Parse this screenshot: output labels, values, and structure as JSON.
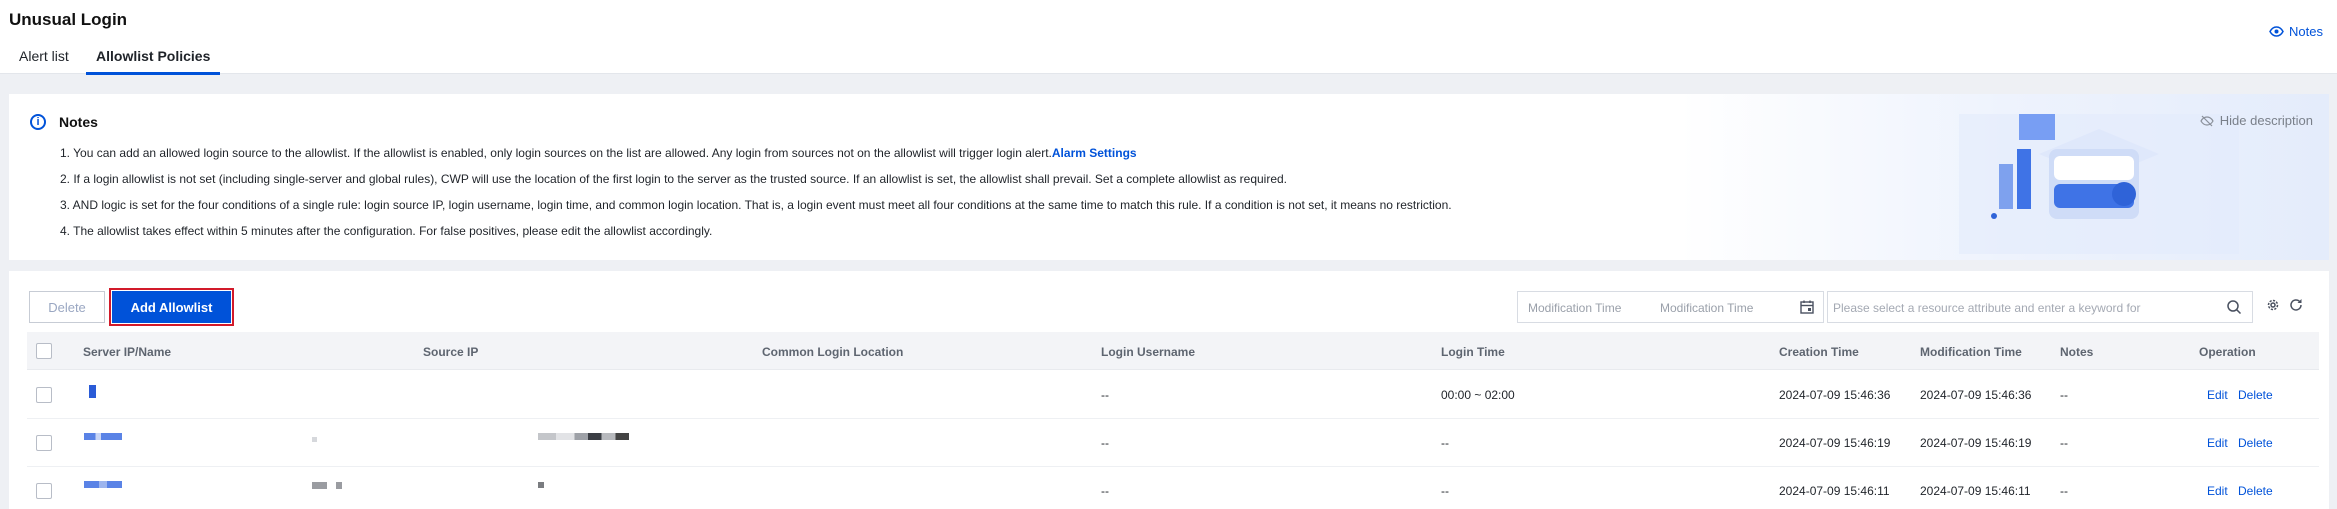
{
  "header": {
    "title": "Unusual Login",
    "notes_link": "Notes",
    "tabs": [
      {
        "label": "Alert list",
        "active": false
      },
      {
        "label": "Allowlist Policies",
        "active": true
      }
    ]
  },
  "notes": {
    "heading": "Notes",
    "hide_label": "Hide description",
    "lines": [
      "1. You can add an allowed login source to the allowlist. If the allowlist is enabled, only login sources on the list are allowed. Any login from sources not on the allowlist will trigger login alert.",
      "2. If a login allowlist is not set (including single-server and global rules), CWP will use the location of the first login to the server as the trusted source. If an allowlist is set, the allowlist shall prevail. Set a complete allowlist as required.",
      "3. AND logic is set for the four conditions of a single rule: login source IP, login username, login time, and common login location. That is, a login event must meet all four conditions at the same time to match this rule. If a condition is not set, it means no restriction.",
      "4. The allowlist takes effect within 5 minutes after the configuration. For false positives, please edit the allowlist accordingly."
    ],
    "alarm_settings_link": "Alarm Settings"
  },
  "toolbar": {
    "delete_label": "Delete",
    "add_label": "Add Allowlist",
    "date_start_placeholder": "Modification Time",
    "date_end_placeholder": "Modification Time",
    "search_placeholder": "Please select a resource attribute and enter a keyword for"
  },
  "table": {
    "columns": [
      "Server IP/Name",
      "Source IP",
      "Common Login Location",
      "Login Username",
      "Login Time",
      "Creation Time",
      "Modification Time",
      "Notes",
      "Operation"
    ],
    "rows": [
      {
        "login_username": "--",
        "login_time": "00:00 ~ 02:00",
        "creation_time": "2024-07-09 15:46:36",
        "modification_time": "2024-07-09 15:46:36",
        "notes": "--",
        "edit": "Edit",
        "delete": "Delete"
      },
      {
        "login_username": "--",
        "login_time": "--",
        "creation_time": "2024-07-09 15:46:19",
        "modification_time": "2024-07-09 15:46:19",
        "notes": "--",
        "edit": "Edit",
        "delete": "Delete"
      },
      {
        "login_username": "--",
        "login_time": "--",
        "creation_time": "2024-07-09 15:46:11",
        "modification_time": "2024-07-09 15:46:11",
        "notes": "--",
        "edit": "Edit",
        "delete": "Delete"
      }
    ]
  },
  "colors": {
    "accent": "#0052d9",
    "highlight_border": "#d21a2a"
  },
  "icons": [
    "eye-icon",
    "info-icon",
    "eye-off-icon",
    "calendar-icon",
    "search-icon",
    "gear-icon",
    "refresh-icon"
  ]
}
